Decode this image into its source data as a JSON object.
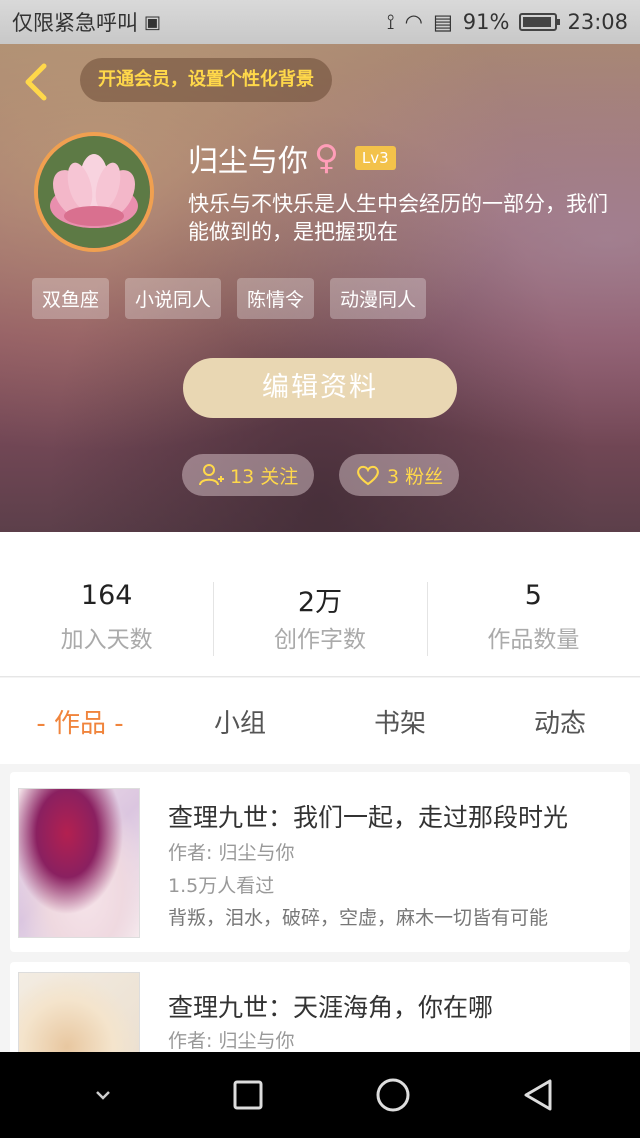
{
  "status_bar": {
    "carrier": "仅限紧急呼叫",
    "battery_percent": "91%",
    "battery_level": 0.91,
    "time": "23:08"
  },
  "header": {
    "vip_banner": "开通会员，设置个性化背景",
    "username": "归尘与你",
    "gender_symbol": "♀",
    "level": "Lv3",
    "bio": "快乐与不快乐是人生中会经历的一部分，我们能做到的，是把握现在",
    "tags": [
      "双鱼座",
      "小说同人",
      "陈情令",
      "动漫同人"
    ],
    "edit_button": "编辑资料",
    "following": "13 关注",
    "followers": "3 粉丝"
  },
  "stats": [
    {
      "value": "164",
      "label": "加入天数"
    },
    {
      "value": "2万",
      "label": "创作字数"
    },
    {
      "value": "5",
      "label": "作品数量"
    }
  ],
  "tabs": [
    "- 作品 -",
    "小组",
    "书架",
    "动态"
  ],
  "works": [
    {
      "title": "查理九世：我们一起，走过那段时光",
      "author": "作者: 归尘与你",
      "views": "1.5万人看过",
      "description": "背叛，泪水，破碎，空虚，麻木一切皆有可能"
    },
    {
      "title": "查理九世：天涯海角，你在哪",
      "author": "作者: 归尘与你"
    }
  ],
  "colors": {
    "accent": "#f0843c",
    "vip_text": "#ffd84a",
    "level_badge": "#f3c24a"
  }
}
